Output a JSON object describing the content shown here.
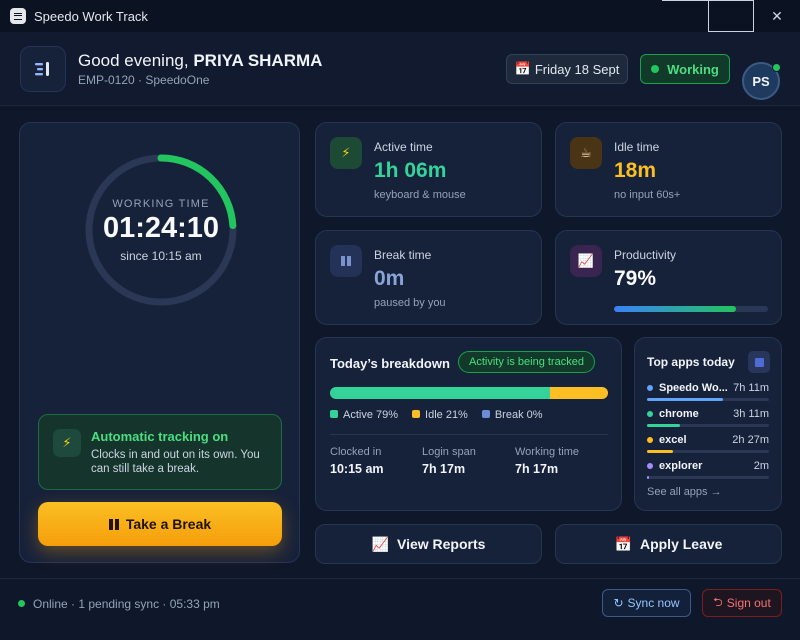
{
  "window": {
    "title": "Speedo Work Track",
    "minimize_icon": "minimize-icon",
    "maximize_icon": "maximize-icon",
    "close_glyph": "✕"
  },
  "header": {
    "greeting": "Good evening,",
    "user_name": "PRIYA SHARMA",
    "employee_line": "EMP-0120 · SpeedoOne",
    "date_icon": "📅",
    "date": "Friday 18 Sept",
    "status": "Working",
    "status_color": "#22c55e",
    "avatar_initials": "PS"
  },
  "timer": {
    "label": "WORKING TIME",
    "time": "01:24:10",
    "since": "since 10:15 am",
    "ring_progress": 0.24,
    "ring_color": "#22c55e"
  },
  "auto_tracking": {
    "icon": "⚡",
    "title": "Automatic tracking on",
    "description": "Clocks in and out on its own. You can still take a break."
  },
  "break_button": {
    "label": "Take a Break"
  },
  "stats": {
    "active": {
      "icon": "⚡",
      "label": "Active time",
      "value": "1h 06m",
      "sub": "keyboard & mouse",
      "color": "#34d399"
    },
    "idle": {
      "icon": "☕",
      "label": "Idle time",
      "value": "18m",
      "sub": "no input 60s+",
      "color": "#fbbf24"
    },
    "break": {
      "label": "Break time",
      "value": "0m",
      "sub": "paused by you",
      "color": "#8aa4d8"
    },
    "productivity": {
      "icon": "📈",
      "label": "Productivity",
      "value": "79%",
      "fraction": 0.79
    }
  },
  "breakdown": {
    "title": "Today’s breakdown",
    "badge": "Activity is being tracked",
    "segments": [
      {
        "name": "Active",
        "label": "Active 79%",
        "fraction": 0.79,
        "color": "#34d399"
      },
      {
        "name": "Idle",
        "label": "Idle 21%",
        "fraction": 0.21,
        "color": "#fbbf24"
      },
      {
        "name": "Break",
        "label": "Break 0%",
        "fraction": 0.0,
        "color": "#6b8cd6"
      }
    ],
    "clocked_in_label": "Clocked in",
    "clocked_in": "10:15 am",
    "login_span_label": "Login span",
    "login_span": "7h 17m",
    "working_time_label": "Working time",
    "working_time": "7h 17m"
  },
  "top_apps": {
    "title": "Top apps today",
    "apps": [
      {
        "name": "Speedo Wo...",
        "time": "7h 11m",
        "fraction": 0.62,
        "color": "#60a5fa"
      },
      {
        "name": "chrome",
        "time": "3h 11m",
        "fraction": 0.27,
        "color": "#34d399"
      },
      {
        "name": "excel",
        "time": "2h 27m",
        "fraction": 0.21,
        "color": "#fbbf24"
      },
      {
        "name": "explorer",
        "time": "2m",
        "fraction": 0.02,
        "color": "#a78bfa"
      }
    ],
    "see_all": "See all apps →"
  },
  "actions": {
    "reports_icon": "📈",
    "reports": "View Reports",
    "leave_icon": "📅",
    "leave": "Apply Leave"
  },
  "footer": {
    "status_text": "Online · 1 pending sync · 05:33 pm",
    "sync_icon": "↻",
    "sync": "Sync now",
    "signout_icon": "⮌",
    "signout": "Sign out"
  }
}
